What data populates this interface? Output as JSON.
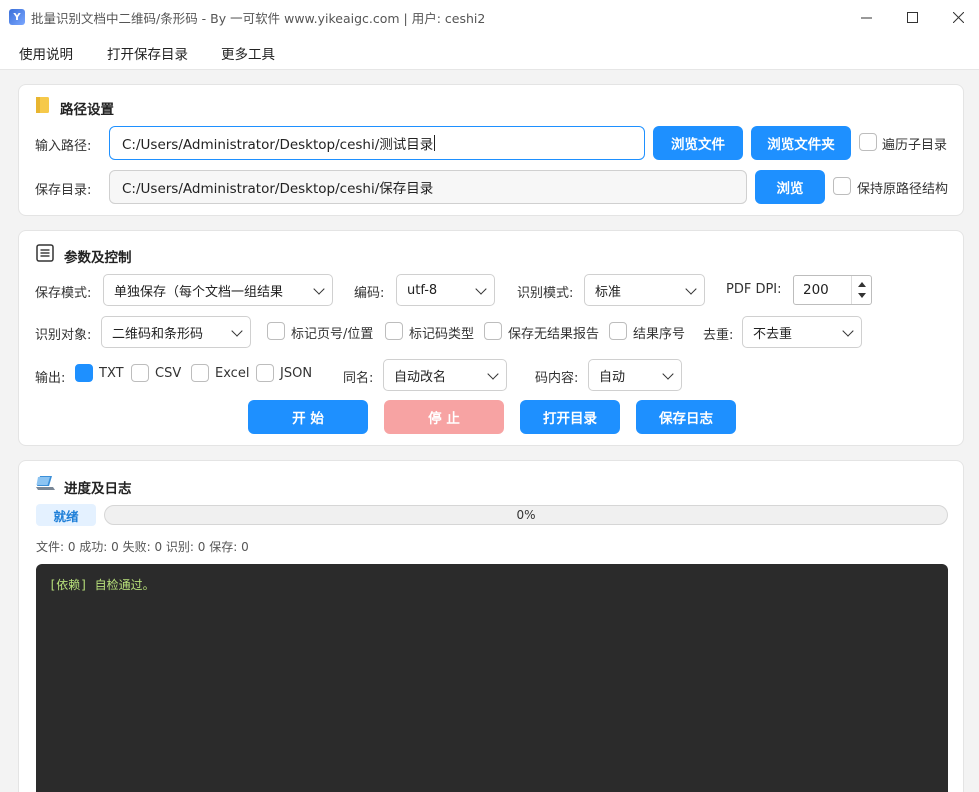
{
  "window": {
    "title": "批量识别文档中二维码/条形码 - By 一可软件 www.yikeaigc.com  |  用户: ceshi2",
    "icon_text": "Y"
  },
  "menu": [
    "使用说明",
    "打开保存目录",
    "更多工具"
  ],
  "path_settings": {
    "title": "路径设置",
    "input_label": "输入路径:",
    "input_value": "C:/Users/Administrator/Desktop/ceshi/测试目录",
    "browse_file": "浏览文件",
    "browse_folder": "浏览文件夹",
    "recurse_label": "遍历子目录",
    "save_label": "保存目录:",
    "save_value": "C:/Users/Administrator/Desktop/ceshi/保存目录",
    "browse": "浏览",
    "keep_structure_label": "保持原路径结构"
  },
  "params": {
    "title": "参数及控制",
    "save_mode_label": "保存模式:",
    "save_mode_value": "单独保存（每个文档一组结果",
    "encoding_label": "编码:",
    "encoding_value": "utf-8",
    "recog_mode_label": "识别模式:",
    "recog_mode_value": "标准",
    "dpi_label": "PDF DPI:",
    "dpi_value": "200",
    "target_label": "识别对象:",
    "target_value": "二维码和条形码",
    "mark_page_label": "标记页号/位置",
    "mark_type_label": "标记码类型",
    "save_empty_label": "保存无结果报告",
    "result_index_label": "结果序号",
    "dedupe_label": "去重:",
    "dedupe_value": "不去重",
    "output_label": "输出:",
    "outputs": [
      {
        "label": "TXT",
        "checked": true
      },
      {
        "label": "CSV",
        "checked": false
      },
      {
        "label": "Excel",
        "checked": false
      },
      {
        "label": "JSON",
        "checked": false
      }
    ],
    "same_name_label": "同名:",
    "same_name_value": "自动改名",
    "content_label": "码内容:",
    "content_value": "自动",
    "start": "开 始",
    "stop": "停 止",
    "open_dir": "打开目录",
    "save_log": "保存日志"
  },
  "progress": {
    "title": "进度及日志",
    "status": "就绪",
    "percent": 0,
    "percent_text": "0%",
    "stats": "文件: 0  成功: 0  失败: 0  识别: 0  保存: 0",
    "log_line": "[依赖] 自检通过。"
  },
  "colors": {
    "accent": "#1e90ff",
    "stop": "#f7a3a3",
    "log_bg": "#2b2b2b",
    "log_text": "#b7e07a"
  }
}
